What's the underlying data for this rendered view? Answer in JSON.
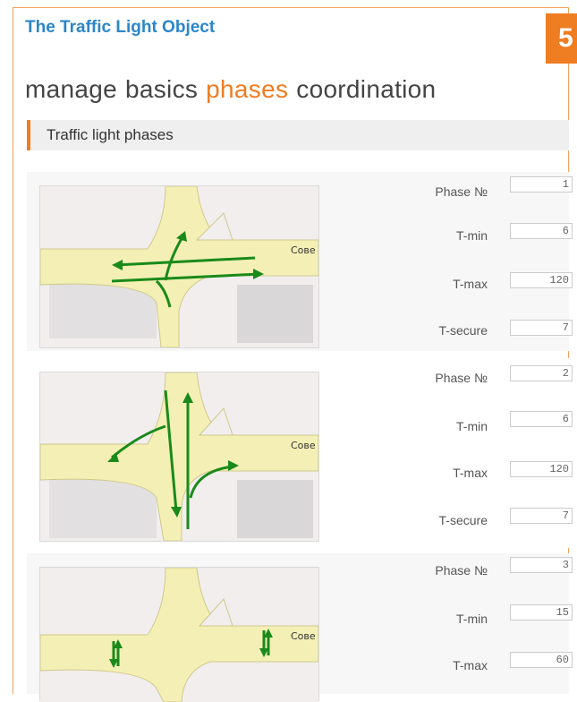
{
  "header": {
    "title": "The Traffic Light Object",
    "page_number": "5"
  },
  "tabs": [
    {
      "label": "manage",
      "active": false
    },
    {
      "label": "basics",
      "active": false
    },
    {
      "label": "phases",
      "active": true
    },
    {
      "label": "coordination",
      "active": false
    }
  ],
  "section": {
    "title": "Traffic light phases"
  },
  "phases": [
    {
      "fields": [
        {
          "label": "Phase №",
          "value": "1"
        },
        {
          "label": "T-min",
          "value": "6"
        },
        {
          "label": "T-max",
          "value": "120"
        },
        {
          "label": "T-secure",
          "value": "7"
        }
      ],
      "map_street_label": "Сове"
    },
    {
      "fields": [
        {
          "label": "Phase №",
          "value": "2"
        },
        {
          "label": "T-min",
          "value": "6"
        },
        {
          "label": "T-max",
          "value": "120"
        },
        {
          "label": "T-secure",
          "value": "7"
        }
      ],
      "map_street_label": "Сове"
    },
    {
      "fields": [
        {
          "label": "Phase №",
          "value": "3"
        },
        {
          "label": "T-min",
          "value": "15"
        },
        {
          "label": "T-max",
          "value": "60"
        }
      ],
      "map_street_label": "Сове"
    }
  ],
  "colors": {
    "accent": "#ef7d22",
    "title_blue": "#2c86c7",
    "arrow_green": "#1a8a1a",
    "road_yellow": "#f4f0b5"
  }
}
